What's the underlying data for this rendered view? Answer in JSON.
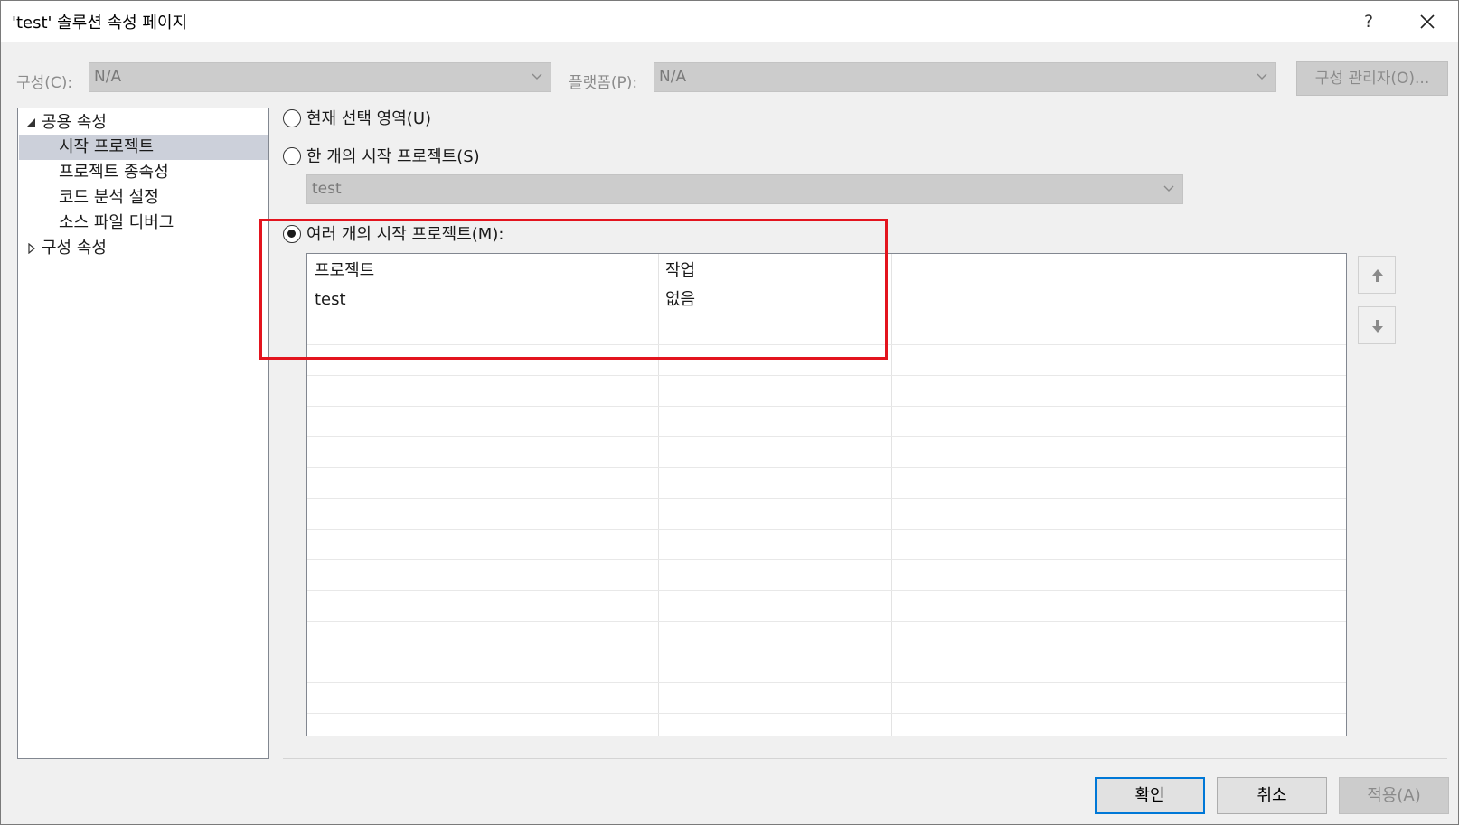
{
  "window": {
    "title": "'test' 솔루션 속성 페이지",
    "help_label": "?",
    "close_icon": "close-icon"
  },
  "toolbar": {
    "config_label": "구성(C):",
    "config_value": "N/A",
    "platform_label": "플랫폼(P):",
    "platform_value": "N/A",
    "config_manager_label": "구성 관리자(O)..."
  },
  "tree": {
    "common_group": "공용 속성",
    "items": [
      "시작 프로젝트",
      "프로젝트 종속성",
      "코드 분석 설정",
      "소스 파일 디버그"
    ],
    "selected_index": 0,
    "config_group": "구성 속성"
  },
  "startup": {
    "current_selection_label": "현재 선택 영역(U)",
    "single_label": "한 개의 시작 프로젝트(S)",
    "single_value": "test",
    "multiple_label": "여러 개의 시작 프로젝트(M):",
    "selected_option": "multiple"
  },
  "grid": {
    "columns": [
      "프로젝트",
      "작업"
    ],
    "rows": [
      {
        "project": "test",
        "action": "없음"
      }
    ]
  },
  "move_buttons": {
    "up_icon": "arrow-up-icon",
    "down_icon": "arrow-down-icon"
  },
  "footer": {
    "ok_label": "확인",
    "cancel_label": "취소",
    "apply_label": "적용(A)"
  },
  "colors": {
    "highlight": "#e3141e",
    "selected_row": "#ccd0da",
    "default_button_border": "#0078d7"
  }
}
